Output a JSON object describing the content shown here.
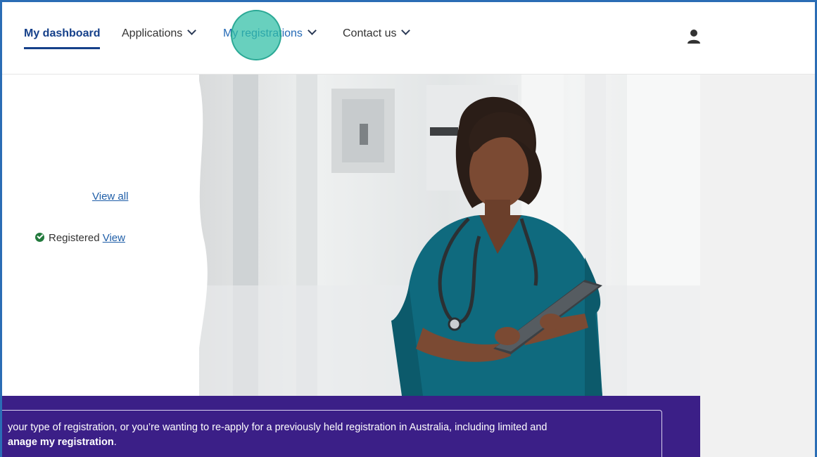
{
  "nav": {
    "items": [
      {
        "label": "My dashboard",
        "active": true,
        "dropdown": false
      },
      {
        "label": "Applications",
        "active": false,
        "dropdown": true
      },
      {
        "label": "My registrations",
        "active": false,
        "dropdown": true
      },
      {
        "label": "Contact us",
        "active": false,
        "dropdown": true
      }
    ],
    "user_icon": "user-icon",
    "chevron_icon": "chevron-down-icon"
  },
  "left_panel": {
    "view_all_label": "View all",
    "status_text": "Registered",
    "status_icon": "check-circle-icon",
    "view_label": "View"
  },
  "hero": {
    "image_subject": "nurse-with-tablet-photo"
  },
  "banner": {
    "line1": "your type of registration, or you’re wanting to re-apply for a previously held registration in Australia, including limited and",
    "line2_bold": "anage my registration",
    "line2_end": "."
  },
  "colors": {
    "brand_blue": "#15408a",
    "link_blue": "#1f5ea8",
    "banner_purple": "#3b1f87",
    "success_green": "#237a3d",
    "click_indicator": "#2ebea5",
    "nurse_scrubs": "#0f6a7e"
  }
}
